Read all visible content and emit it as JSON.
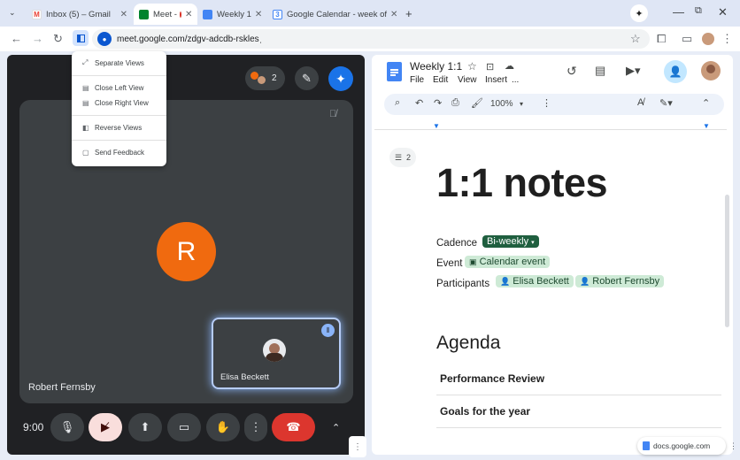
{
  "browser": {
    "tabs": [
      {
        "title": "Inbox (5) – Gmail",
        "active": false
      },
      {
        "title": "Meet -",
        "active": true
      },
      {
        "title": "Weekly 1",
        "active": false
      },
      {
        "title": "Google Calendar - week of",
        "active": false
      }
    ],
    "new_tab": "+",
    "url": "meet.google.com/zdgv-adcdb-rsklesˌ"
  },
  "split_menu": {
    "items": [
      "Separate Views",
      "Close Left View",
      "Close Right View",
      "Reverse Views",
      "Send Feedback"
    ]
  },
  "meet": {
    "participant_count": "2",
    "main_participant": "Robert Fernsby",
    "main_initial": "R",
    "pip_participant": "Elisa Beckett",
    "time": "9:00",
    "colors": {
      "avatar": "#f06a0f",
      "end_call": "#dc362e",
      "camera_off": "#f9dedc"
    }
  },
  "docs": {
    "title": "Weekly 1:1",
    "menus": [
      "File",
      "Edit",
      "View",
      "Insert",
      "..."
    ],
    "zoom": "100%",
    "comment_count": "2",
    "heading": "1:1 notes",
    "properties": {
      "cadence_label": "Cadence",
      "cadence_value": "Bi-weekly",
      "event_label": "Event",
      "event_value": "Calendar event",
      "participants_label": "Participants",
      "participant_1": "Elisa Beckett",
      "participant_2": "Robert Fernsby"
    },
    "agenda_heading": "Agenda",
    "agenda_items": [
      "Performance Review",
      "Goals for the year"
    ],
    "domain_badge": "docs.google.com"
  }
}
